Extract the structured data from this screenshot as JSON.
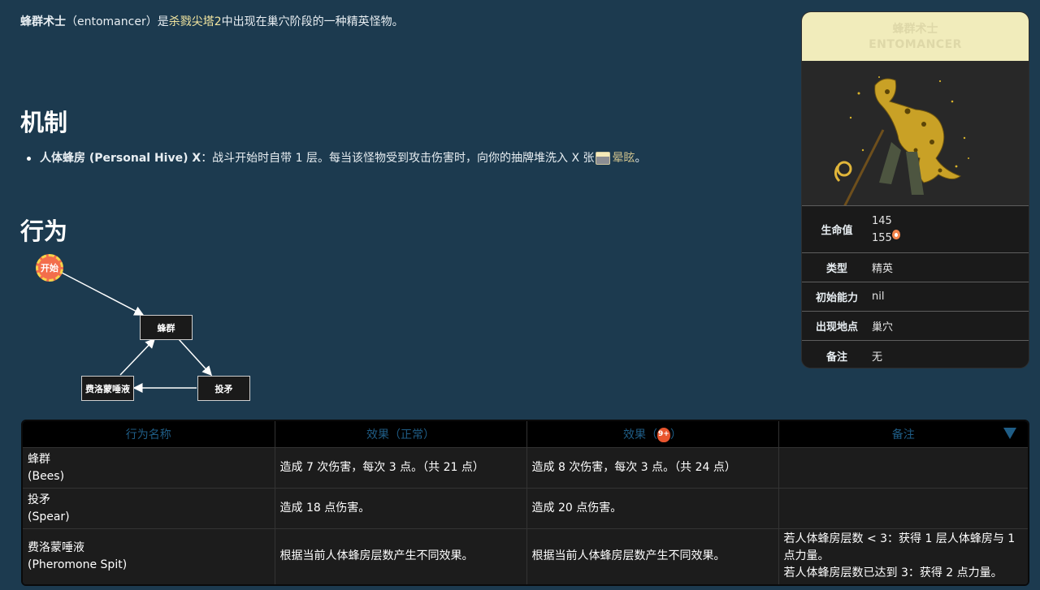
{
  "intro": {
    "name": "蜂群术士",
    "en": "（entomancer）是",
    "game": "杀戮尖塔2",
    "rest": "中出现在巢穴阶段的一种精英怪物。"
  },
  "mechanics": {
    "heading": "机制",
    "item_name": "人体蜂房 (Personal Hive) X",
    "item_text": "：战斗开始时自带 1 层。每当该怪物受到攻击伤害时，向你的抽牌堆洗入 X 张",
    "card_name": "晕眩",
    "end": "。"
  },
  "behavior": {
    "heading": "行为",
    "start_label": "开始",
    "nodes": [
      "蜂群",
      "费洛蒙唾液",
      "投矛"
    ]
  },
  "infobox": {
    "title_cn": "蜂群术士",
    "title_en": "ENTOMANCER",
    "rows": [
      {
        "key": "生命值",
        "value": "145",
        "value2": "155"
      },
      {
        "key": "类型",
        "value": "精英"
      },
      {
        "key": "初始能力",
        "value": "nil"
      },
      {
        "key": "出现地点",
        "value": "巢穴"
      },
      {
        "key": "备注",
        "value": "无"
      }
    ]
  },
  "table": {
    "headers": [
      "行为名称",
      "效果（正常）",
      "效果（",
      "）",
      "备注"
    ],
    "rows": [
      {
        "name": "蜂群",
        "name_en": "(Bees)",
        "normal": "造成 7 次伤害，每次 3 点。（共 21 点）",
        "ascended": "造成 8 次伤害，每次 3 点。（共 24 点）",
        "note": "",
        "note2": ""
      },
      {
        "name": "投矛",
        "name_en": "(Spear)",
        "normal": "造成 18 点伤害。",
        "ascended": "造成 20 点伤害。",
        "note": "",
        "note2": ""
      },
      {
        "name": "费洛蒙唾液",
        "name_en": "(Pheromone Spit)",
        "normal": "根据当前人体蜂房层数产生不同效果。",
        "ascended": "根据当前人体蜂房层数产生不同效果。",
        "note": "若人体蜂房层数 < 3：获得 1 层人体蜂房与 1 点力量。",
        "note2": "若人体蜂房层数已达到 3：获得 2 点力量。"
      }
    ]
  },
  "colors": {
    "background": "#1c3a4f",
    "link": "#f3e6a0",
    "header_text": "#1f5d86"
  }
}
